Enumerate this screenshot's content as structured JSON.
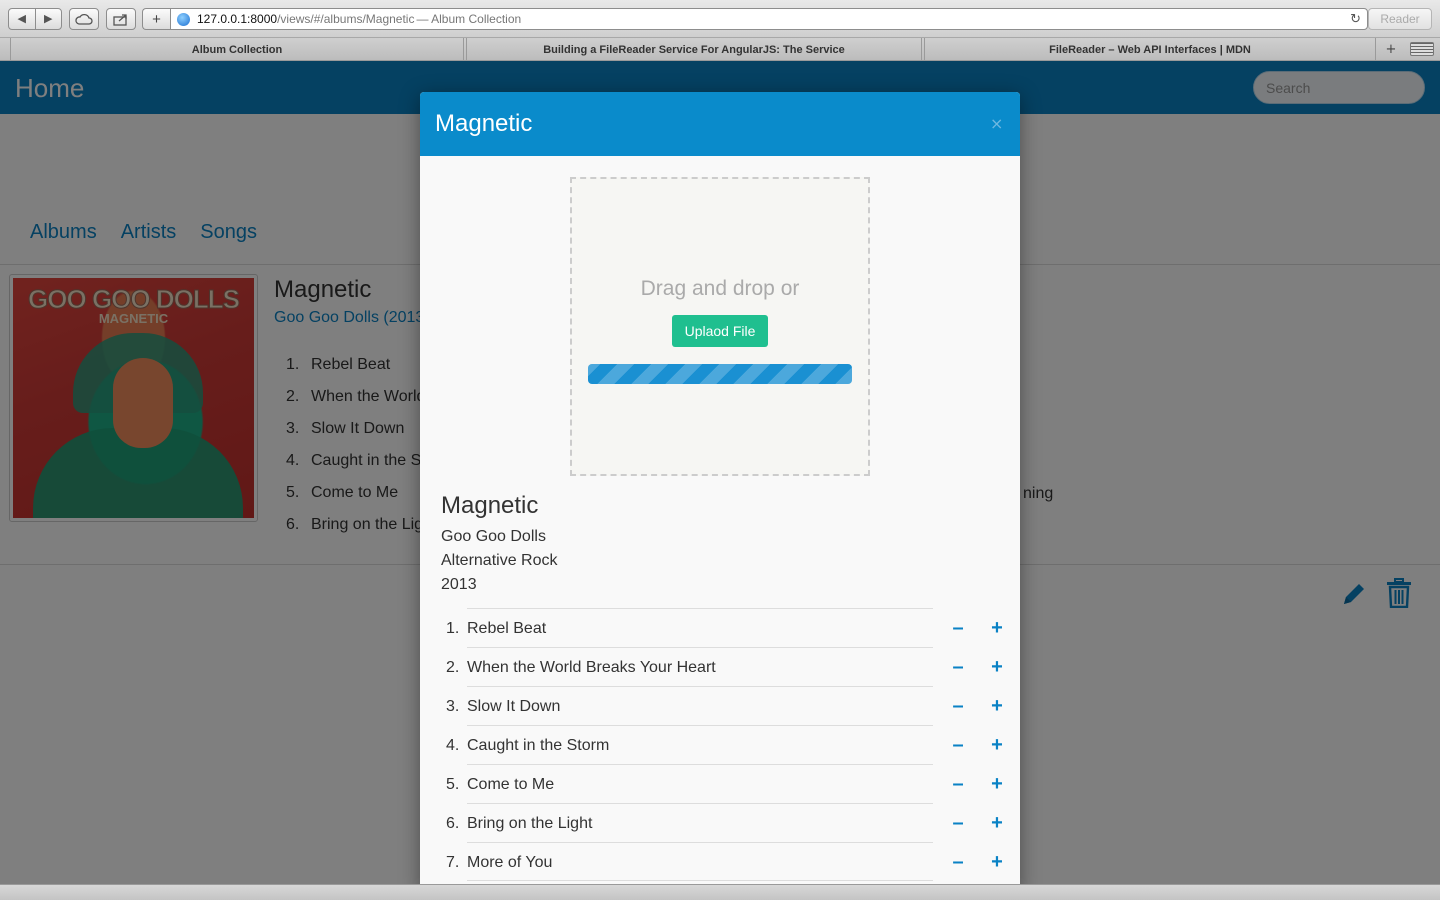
{
  "browser": {
    "nav_back": "◀",
    "nav_forward": "▶",
    "new_tab_plus": "+",
    "address_host": "127.0.0.1:8000",
    "address_path": "/views/#/albums/Magnetic",
    "address_title": " — Album Collection",
    "reader_label": "Reader",
    "reload_glyph": "↻",
    "tabs": [
      {
        "label": "Album Collection"
      },
      {
        "label": "Building a FileReader Service For AngularJS: The Service"
      },
      {
        "label": "FileReader – Web API Interfaces | MDN"
      }
    ],
    "tab_add": "+"
  },
  "app": {
    "brand": "Home",
    "search_placeholder": "Search",
    "nav": [
      "Albums",
      "Artists",
      "Songs"
    ],
    "accent_color": "#0a82c5"
  },
  "background_album": {
    "cover_band": "GOO GOO DOLLS",
    "cover_title": "MAGNETIC",
    "title": "Magnetic",
    "artist_line": "Goo Goo Dolls (2013",
    "tracks": [
      {
        "num": "1.",
        "name": "Rebel Beat"
      },
      {
        "num": "2.",
        "name": "When the World"
      },
      {
        "num": "3.",
        "name": "Slow It Down"
      },
      {
        "num": "4.",
        "name": "Caught in the S"
      },
      {
        "num": "5.",
        "name": "Come to Me"
      },
      {
        "num": "6.",
        "name": "Bring on the Lig"
      }
    ],
    "right_fragment": "ning"
  },
  "modal": {
    "title": "Magnetic",
    "close": "×",
    "dropzone_text": "Drag and drop or",
    "upload_label": "Uplaod File",
    "progress": 1.0,
    "album": {
      "title": "Magnetic",
      "artist": "Goo Goo Dolls",
      "genre": "Alternative Rock",
      "year": "2013"
    },
    "minus_label": "–",
    "plus_label": "+",
    "tracks": [
      {
        "num": "1.",
        "name": "Rebel Beat"
      },
      {
        "num": "2.",
        "name": "When the World Breaks Your Heart"
      },
      {
        "num": "3.",
        "name": "Slow It Down"
      },
      {
        "num": "4.",
        "name": "Caught in the Storm"
      },
      {
        "num": "5.",
        "name": "Come to Me"
      },
      {
        "num": "6.",
        "name": "Bring on the Light"
      },
      {
        "num": "7.",
        "name": "More of You"
      }
    ]
  }
}
